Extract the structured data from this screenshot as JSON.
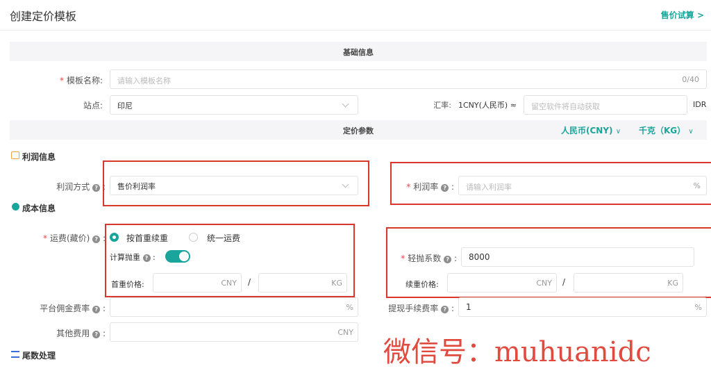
{
  "header": {
    "title": "创建定价模板",
    "trial_link": "售价试算 >"
  },
  "basic_band": {
    "title": "基础信息"
  },
  "template_name": {
    "label": "模板名称:",
    "placeholder": "请输入模板名称",
    "counter": "0/40"
  },
  "site": {
    "label": "站点:",
    "value": "印尼"
  },
  "rate": {
    "label": "汇率:",
    "base": "1CNY(人民币) ≈",
    "placeholder": "留空软件将自动获取",
    "unit": "IDR"
  },
  "pricing_band": {
    "title": "定价参数",
    "currency": "人民币(CNY)",
    "weight_unit": "千克（KG）"
  },
  "profit_section": {
    "title": "利润信息",
    "method_label": "利润方式",
    "method_value": "售价利润率",
    "rate_label": "利润率",
    "rate_placeholder": "请输入利润率",
    "rate_unit": "%"
  },
  "cost_section": {
    "title": "成本信息"
  },
  "freight": {
    "label": "运费(藏价)",
    "option1": "按首重续重",
    "option2": "统一运费",
    "calc_light": "计算抛重",
    "first_weight_label": "首重价格:",
    "first_currency": "CNY",
    "first_unit": "KG",
    "slash": "/",
    "light_factor_label": "轻抛系数",
    "light_factor_value": "8000",
    "cont_label": "续重价格:",
    "cont_currency": "CNY",
    "cont_unit": "KG"
  },
  "commission": {
    "label": "平台佣金费率",
    "unit": "%"
  },
  "withdraw": {
    "label": "提现手续费率",
    "value": "1",
    "unit": "%"
  },
  "other": {
    "label": "其他费用",
    "unit": "CNY"
  },
  "tail_section": {
    "title": "尾数处理"
  },
  "watermark": {
    "text": "微信号：muhuanidc"
  },
  "colors": {
    "accent": "#19a59b",
    "highlight_box": "#d9362c",
    "required": "#e64545"
  }
}
